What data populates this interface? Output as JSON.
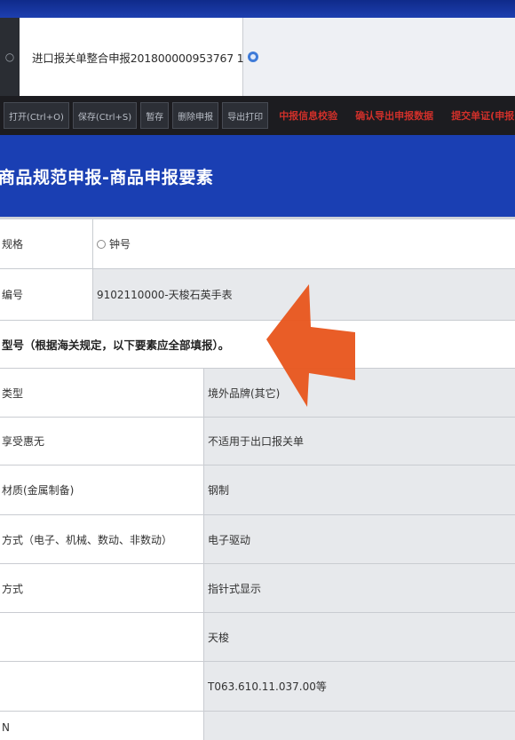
{
  "window": {
    "title_bar": ""
  },
  "tabs": {
    "left_stub": "○",
    "active": {
      "label": "进口报关单整合申报201800000953767 1"
    }
  },
  "toolbar": {
    "buttons": [
      "打开(Ctrl+O)",
      "保存(Ctrl+S)",
      "暂存",
      "删除申报",
      "导出打印"
    ],
    "red_links": [
      "中报信息校验",
      "确认导出申报数据",
      "提交单证(申报)"
    ]
  },
  "section": {
    "title": "商品规范申报-商品申报要素"
  },
  "form": {
    "rows": [
      {
        "label": "规格",
        "value": "钟号",
        "radio": true
      },
      {
        "label": "编号",
        "value": "9102110000-天梭石英手表"
      }
    ],
    "hint": "型号（根据海关规定，以下要素应全部填报）。",
    "element_rows": [
      {
        "label": "类型",
        "value": "境外品牌(其它)"
      },
      {
        "label": "享受惠无",
        "value": "不适用于出口报关单"
      },
      {
        "label": "材质(金属制备)",
        "value": "钢制"
      },
      {
        "label": "方式（电子、机械、数动、非数动）",
        "value": "电子驱动"
      },
      {
        "label": "方式",
        "value": "指针式显示"
      },
      {
        "label": "",
        "value": "天梭"
      },
      {
        "label": "",
        "value": "T063.610.11.037.00等"
      },
      {
        "label": "N",
        "value": ""
      }
    ]
  },
  "annotation": {
    "arrow_color": "#e8561e"
  }
}
